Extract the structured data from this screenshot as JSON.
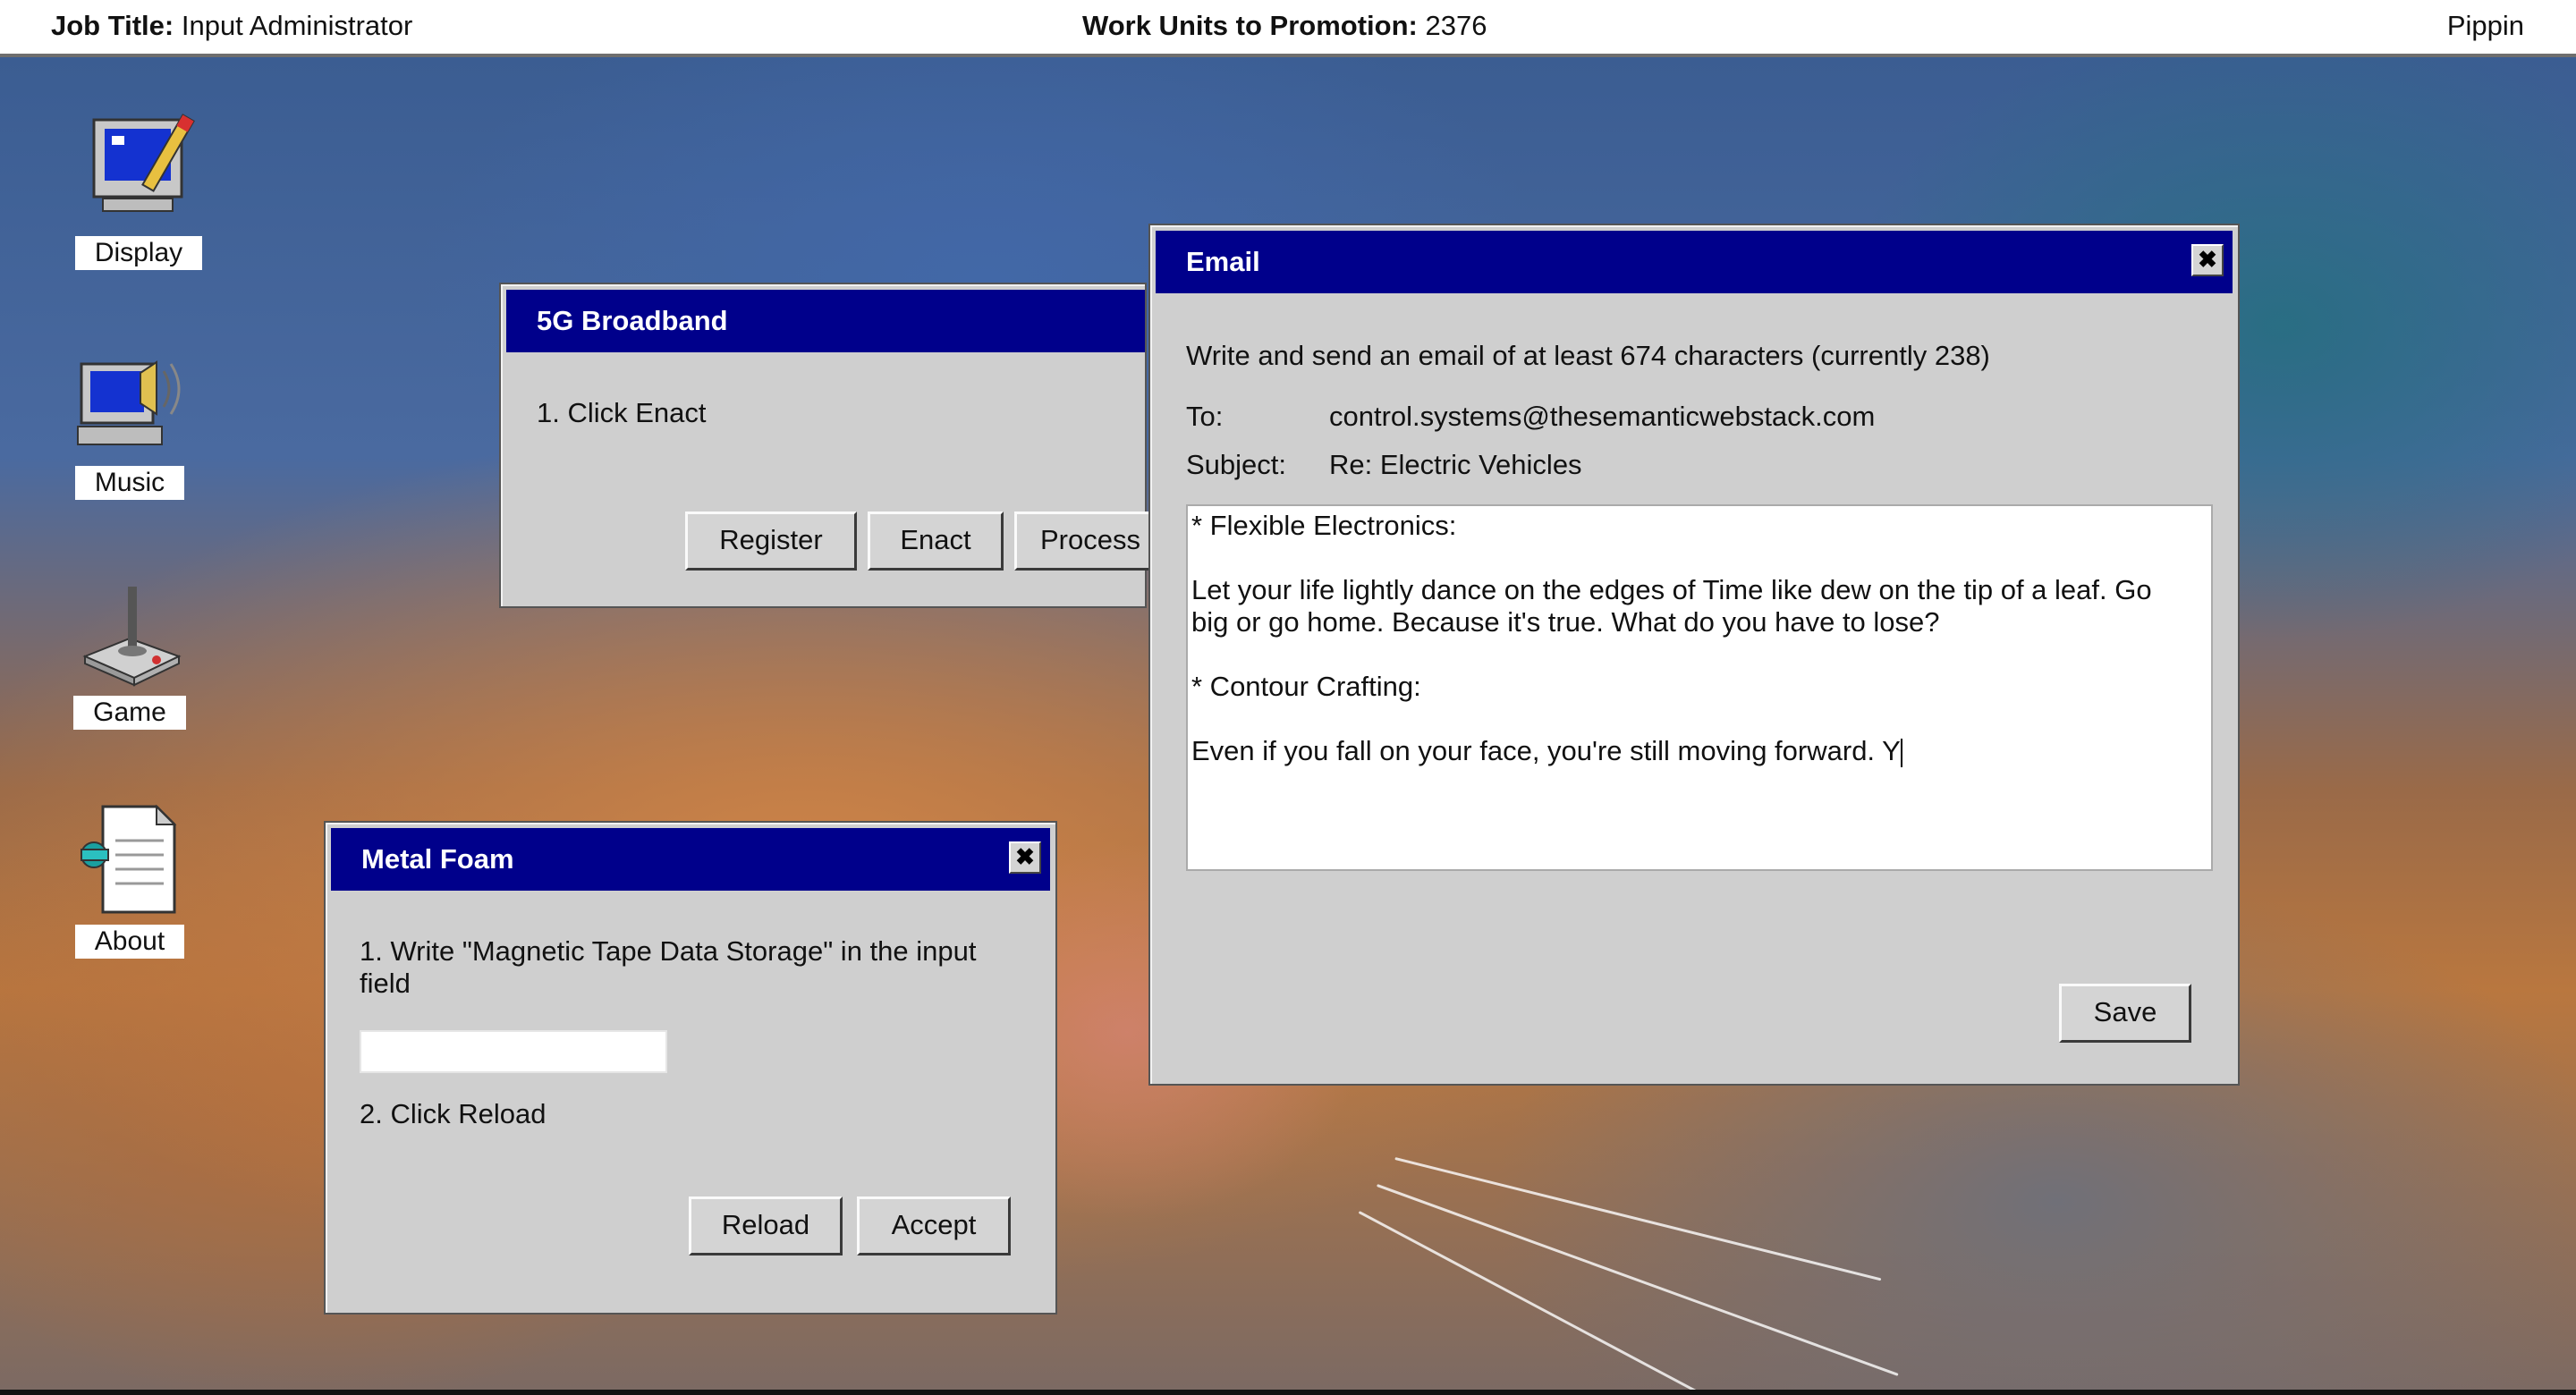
{
  "topbar": {
    "job_title_label": "Job Title:",
    "job_title_value": "Input Administrator",
    "work_units_label": "Work Units to Promotion:",
    "work_units_value": "2376",
    "user_name": "Pippin"
  },
  "desktop_icons": [
    {
      "label": "Display",
      "icon": "display-icon"
    },
    {
      "label": "Music",
      "icon": "music-icon"
    },
    {
      "label": "Game",
      "icon": "joystick-icon"
    },
    {
      "label": "About",
      "icon": "document-icon"
    }
  ],
  "broadband_window": {
    "title": "5G Broadband",
    "instruction": "1. Click Enact",
    "buttons": [
      "Register",
      "Enact",
      "Process"
    ]
  },
  "metal_foam_window": {
    "title": "Metal Foam",
    "instruction_1": "1. Write \"Magnetic Tape Data Storage\" in the input field",
    "input_value": "",
    "instruction_2": "2. Click Reload",
    "buttons": [
      "Reload",
      "Accept"
    ],
    "close_symbol": "✖"
  },
  "email_window": {
    "title": "Email",
    "close_symbol": "✖",
    "instruction": "Write and send an email of at least 674 characters (currently 238)",
    "to_label": "To:",
    "to_value": "control.systems@thesemanticwebstack.com",
    "subject_label": "Subject:",
    "subject_value": "Re: Electric Vehicles",
    "body_lines": [
      "* Flexible Electronics:",
      "",
      "Let your life lightly dance on the edges of Time like dew on the tip of a leaf. Go",
      "big or go home. Because it's true. What do you have to lose?",
      "",
      "* Contour Crafting:",
      "",
      "Even if you fall on your face, you're still moving forward. Y"
    ],
    "save_label": "Save"
  }
}
